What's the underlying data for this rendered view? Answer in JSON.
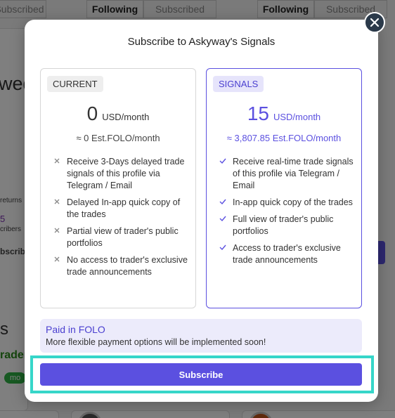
{
  "background": {
    "tabs_left": {
      "subscribed": "Subscribed"
    },
    "tabs_mid": {
      "following": "Following",
      "subscribed": "Subscribed"
    },
    "tabs_right": {
      "following": "Following",
      "subscribed": "Subscribed"
    },
    "heading_fragment": "wed",
    "returns_fragment": "returns",
    "count_fragment": "5",
    "subscribers_fragment": "cribers",
    "subscribe_fragment": "bscrib",
    "section_fragment": "s",
    "trader_fragment": "rader",
    "tag_fragment": "mo"
  },
  "modal": {
    "title": "Subscribe to Askyway's Signals",
    "close_label": "×",
    "plans": {
      "current": {
        "badge": "CURRENT",
        "price": "0",
        "unit": "USD/month",
        "est": "≈ 0 Est.FOLO/month",
        "features": [
          "Receive 3-Days delayed trade signals of this profile via Telegram / Email",
          "Delayed In-app quick copy of the trades",
          "Partial view of trader's public portfolios",
          "No access to trader's exclusive trade announcements"
        ]
      },
      "signals": {
        "badge": "SIGNALS",
        "price": "15",
        "unit": "USD/month",
        "est": "≈ 3,807.85 Est.FOLO/month",
        "features": [
          "Receive real-time trade signals of this profile via Telegram / Email",
          "In-app quick copy of the trades",
          "Full view of trader's public portfolios",
          "Access to trader's exclusive trade announcements"
        ]
      }
    },
    "notice": {
      "title": "Paid in FOLO",
      "text": "More flexible payment options will be implemented soon!"
    },
    "subscribe_label": "Subscribe"
  },
  "colors": {
    "accent": "#5b50e0",
    "highlight": "#36d6c9",
    "close_bg": "#2b3a4a"
  },
  "icons": {
    "close": "close-icon",
    "cross": "x-icon",
    "check": "check-icon"
  }
}
